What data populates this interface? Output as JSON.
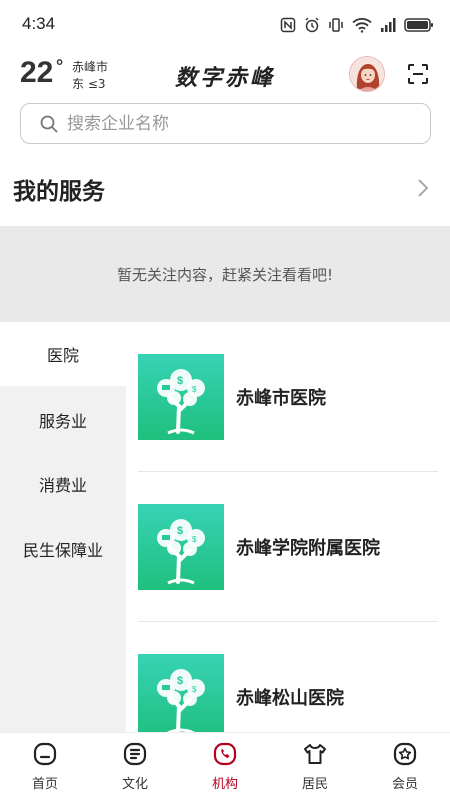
{
  "status_bar": {
    "time": "4:34"
  },
  "header": {
    "temperature": "22",
    "degree_symbol": "°",
    "city": "赤峰市",
    "wind": "东  ≤3",
    "app_title": "数字赤峰"
  },
  "search": {
    "placeholder": "搜索企业名称",
    "value": ""
  },
  "services": {
    "title": "我的服务",
    "empty_message": "暂无关注内容，赶紧关注看看吧!"
  },
  "categories": [
    {
      "label": "医院",
      "active": true
    },
    {
      "label": "服务业",
      "active": false
    },
    {
      "label": "消费业",
      "active": false
    },
    {
      "label": "民生保障业",
      "active": false
    }
  ],
  "organizations": [
    {
      "name": "赤峰市医院"
    },
    {
      "name": "赤峰学院附属医院"
    },
    {
      "name": "赤峰松山医院"
    }
  ],
  "bottom_nav": [
    {
      "label": "首页",
      "icon": "home-icon",
      "active": false
    },
    {
      "label": "文化",
      "icon": "culture-icon",
      "active": false
    },
    {
      "label": "机构",
      "icon": "institution-icon",
      "active": true
    },
    {
      "label": "居民",
      "icon": "resident-icon",
      "active": false
    },
    {
      "label": "会员",
      "icon": "member-icon",
      "active": false
    }
  ],
  "colors": {
    "accent": "#b5001e",
    "thumb_green": "#2ac99a"
  }
}
